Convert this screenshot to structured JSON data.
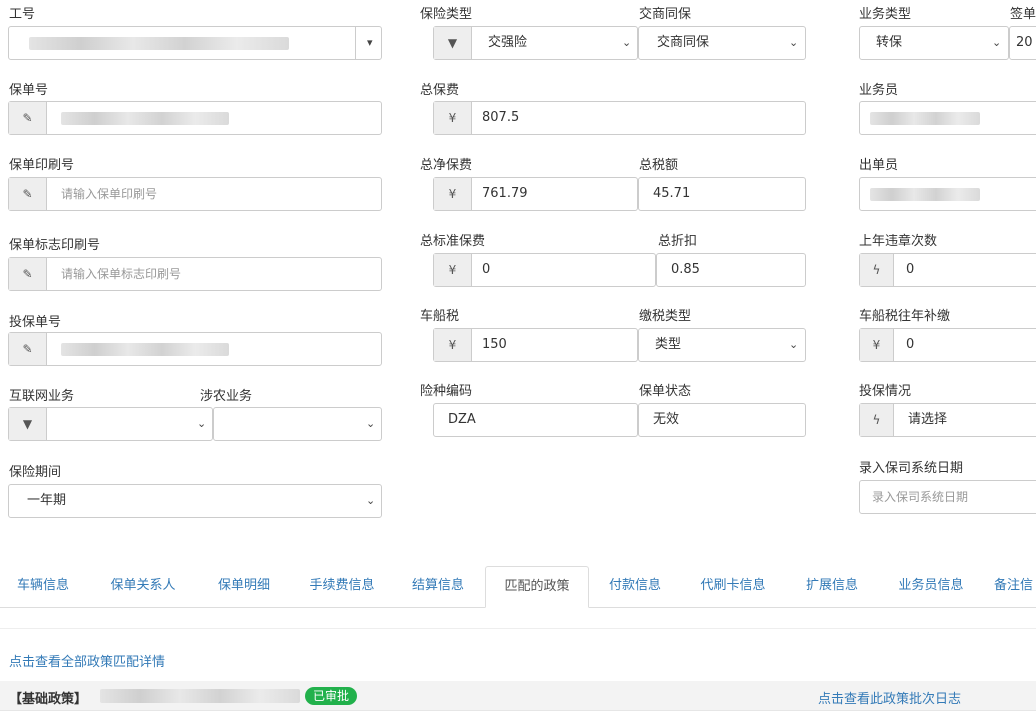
{
  "col1": {
    "employee_no": {
      "label": "工号"
    },
    "policy_no": {
      "label": "保单号"
    },
    "print_no": {
      "label": "保单印刷号",
      "placeholder": "请输入保单印刷号"
    },
    "mark_print_no": {
      "label": "保单标志印刷号",
      "placeholder": "请输入保单标志印刷号"
    },
    "proposal_no": {
      "label": "投保单号"
    },
    "internet_biz": {
      "label": "互联网业务"
    },
    "agri_biz": {
      "label": "涉农业务"
    },
    "period": {
      "label": "保险期间",
      "value": "一年期"
    }
  },
  "col2": {
    "insurance_type": {
      "label": "保险类型",
      "value": "交强险"
    },
    "jiaoshang": {
      "label": "交商同保",
      "value": "交商同保"
    },
    "total_premium": {
      "label": "总保费",
      "currency": "¥",
      "value": "807.5"
    },
    "net_premium": {
      "label": "总净保费",
      "currency": "¥",
      "value": "761.79"
    },
    "total_tax": {
      "label": "总税额",
      "value": "45.71"
    },
    "std_premium": {
      "label": "总标准保费",
      "currency": "¥",
      "value": "0"
    },
    "discount": {
      "label": "总折扣",
      "value": "0.85"
    },
    "vessel_tax": {
      "label": "车船税",
      "currency": "¥",
      "value": "150"
    },
    "tax_type": {
      "label": "缴税类型",
      "value": "类型"
    },
    "risk_code": {
      "label": "险种编码",
      "value": "DZA"
    },
    "policy_status": {
      "label": "保单状态",
      "value": "无效"
    }
  },
  "col3": {
    "biz_type": {
      "label": "业务类型",
      "value": "转保"
    },
    "sign": {
      "label": "签单",
      "value": "20"
    },
    "salesman": {
      "label": "业务员"
    },
    "issuer": {
      "label": "出单员"
    },
    "violations": {
      "label": "上年违章次数",
      "value": "0"
    },
    "vessel_tax_back": {
      "label": "车船税往年补缴",
      "currency": "¥",
      "value": "0"
    },
    "insure_status": {
      "label": "投保情况",
      "value": "请选择"
    },
    "entry_date": {
      "label": "录入保司系统日期",
      "placeholder": "录入保司系统日期"
    }
  },
  "tabs": [
    "车辆信息",
    "保单关系人",
    "保单明细",
    "手续费信息",
    "结算信息",
    "匹配的政策",
    "付款信息",
    "代刷卡信息",
    "扩展信息",
    "业务员信息",
    "备注信"
  ],
  "policy": {
    "view_all_link": "点击查看全部政策匹配详情",
    "base_policy_label": "【基础政策】",
    "approved_badge": "已审批",
    "view_log_link": "点击查看此政策批次日志"
  },
  "colors": {
    "link": "#337ab7",
    "badge": "#22b14c"
  }
}
